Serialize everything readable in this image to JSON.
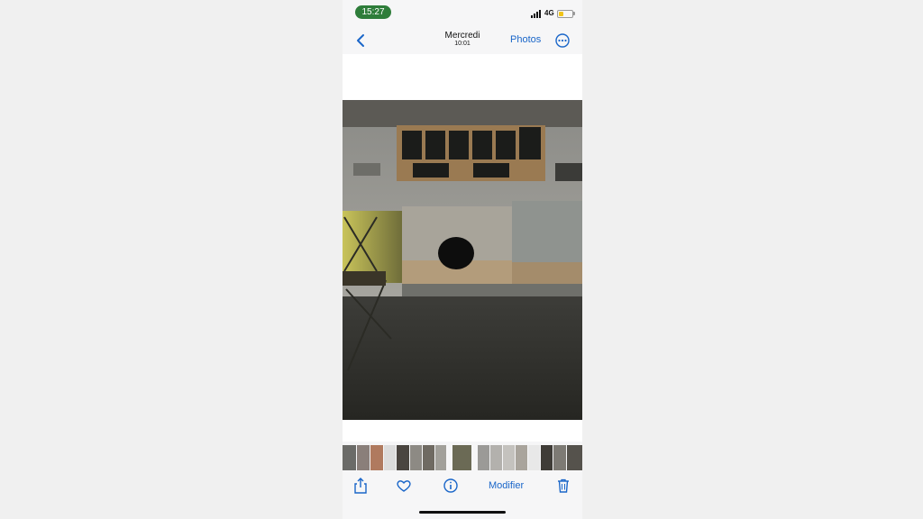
{
  "status_bar": {
    "time": "15:27",
    "network": "4G"
  },
  "nav": {
    "title": "Mercredi",
    "subtitle": "10:01",
    "photos_label": "Photos"
  },
  "photo": {
    "description_icon": "bakery-counter-photo"
  },
  "toolbar": {
    "modifier_label": "Modifier"
  },
  "colors": {
    "accent": "#1a66c9",
    "time_pill": "#2e7d3a"
  }
}
